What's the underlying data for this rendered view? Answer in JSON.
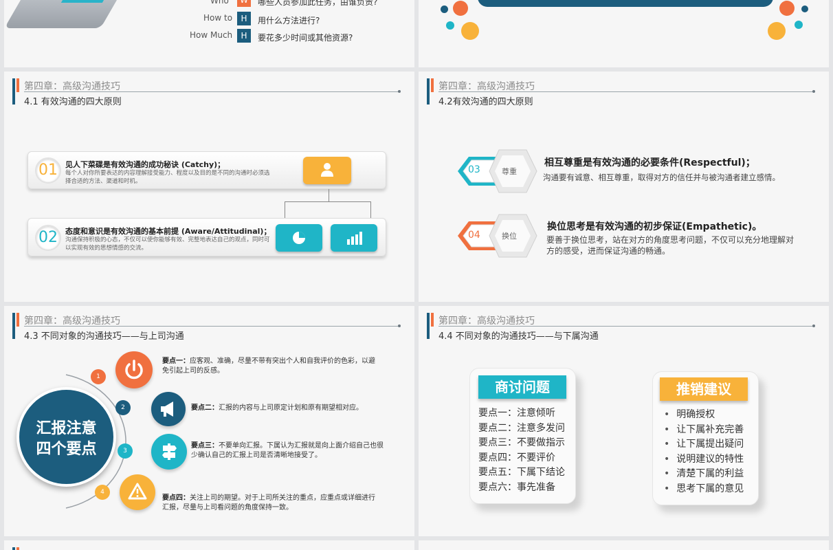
{
  "colors": {
    "navy": "#1c5d7e",
    "teal": "#1fb5c7",
    "orange": "#f0703f",
    "yellow": "#f8b23a",
    "gray": "#8c8c8c"
  },
  "top_left": {
    "rows": [
      {
        "label": "Who",
        "letter": "W",
        "text": "哪些人员参加此任务，由谁负责?",
        "color": "#f0703f"
      },
      {
        "label": "How to",
        "letter": "H",
        "text": "用什么方法进行?",
        "color": "#1c5d7e"
      },
      {
        "label": "How Much",
        "letter": "H",
        "text": "要花多少时间或其他资源?",
        "color": "#1c5d7e"
      }
    ]
  },
  "chapter": "第四章：高级沟通技巧",
  "slide1": {
    "section": "4.1 有效沟通的四大原则",
    "cards": [
      {
        "num": "01",
        "title": "见人下菜碟是有效沟通的成功秘诀 (Catchy)；",
        "text": "每个人对你所要表达的内容理解接受能力、程度以及目的是不同的沟通时必须选择合适的方法、渠道和时机。",
        "num_color": "#f8b23a",
        "icons": [
          "user-icon"
        ]
      },
      {
        "num": "02",
        "title": "态度和意识是有效沟通的基本前提 (Aware/Attitudinal)；",
        "text": "沟通保持积极的心态，不仅可以使你能够有效、完整地表达自己的观点，同时可以实现有效的思想情感的交流。",
        "num_color": "#1fb5c7",
        "icons": [
          "pie-chart-icon",
          "bar-chart-icon"
        ]
      }
    ]
  },
  "slide2": {
    "section": "4.2有效沟通的四大原则",
    "items": [
      {
        "num": "03",
        "hex": "尊重",
        "title": "相互尊重是有效沟通的必要条件(Respectful)；",
        "text": "沟通要有诚意、相互尊重，取得对方的信任并与被沟通者建立感情。",
        "color": "#1fb5c7"
      },
      {
        "num": "04",
        "hex": "换位",
        "title": "换位思考是有效沟通的初步保证(Empathetic)。",
        "text": "要善于换位思考，站在对方的角度思考问题，不仅可以充分地理解对方的感受，进而保证沟通的畅通。",
        "color": "#f0703f"
      }
    ]
  },
  "slide3": {
    "section": "4.3 不同对象的沟通技巧——与上司沟通",
    "center_line1": "汇报注意",
    "center_line2": "四个要点",
    "points": [
      {
        "n": "1",
        "key": "要点一：",
        "text": "应客观、准确，尽量不带有突出个人和自我评价的色彩，以避免引起上司的反感。"
      },
      {
        "n": "2",
        "key": "要点二：",
        "text": "汇报的内容与上司原定计划和原有期望相对应。"
      },
      {
        "n": "3",
        "key": "要点三：",
        "text": "不要单向汇报。下属认为汇报就是向上面介绍自己也很少确认自己的汇报上司是否清晰地接受了。"
      },
      {
        "n": "4",
        "key": "要点四：",
        "text": "关注上司的期望。对于上司所关注的重点，应重点或详细进行汇报，尽量与上司看问题的角度保持一致。"
      }
    ]
  },
  "slide4": {
    "section": "4.4 不同对象的沟通技巧——与下属沟通",
    "left_tag": "商讨问题",
    "left_items": [
      "要点一：注意倾听",
      "要点二：注意多发问",
      "要点三：不要做指示",
      "要点四：不要评价",
      "要点五：下属下结论",
      "要点六：事先准备"
    ],
    "right_tag": "推销建议",
    "right_items": [
      "明确授权",
      "让下属补充完善",
      "让下属提出疑问",
      "说明建议的特性",
      "清楚下属的利益",
      "思考下属的意见"
    ]
  }
}
